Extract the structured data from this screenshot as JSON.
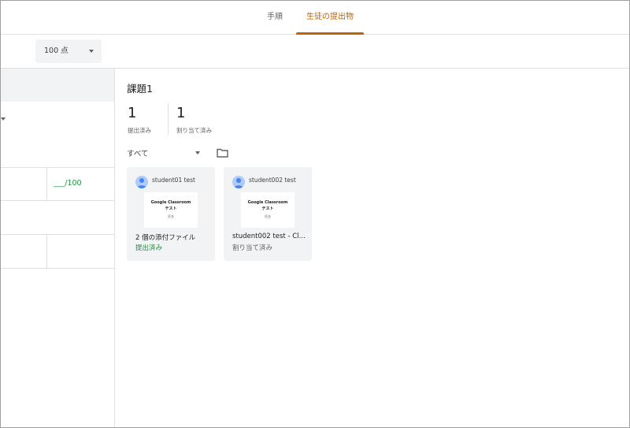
{
  "tabs": [
    {
      "label": "手順",
      "active": false
    },
    {
      "label": "生徒の提出物",
      "active": true
    }
  ],
  "toolbar": {
    "points": "100 点"
  },
  "grade": "___/100",
  "assignment": {
    "title": "課題1",
    "turned_in": {
      "count": "1",
      "label": "提出済み"
    },
    "assigned": {
      "count": "1",
      "label": "割り当て済み"
    }
  },
  "filter": {
    "label": "すべて"
  },
  "students": [
    {
      "name": "student01 test",
      "thumb_title": "Google Classroom",
      "thumb_sub": "テスト",
      "thumb_note": "氏名",
      "attachment": "2 個の添付ファイル",
      "status": "提出済み",
      "status_color": "#1e8e3e"
    },
    {
      "name": "student002 test",
      "thumb_title": "Google Classroom",
      "thumb_sub": "テスト",
      "thumb_note": "氏名",
      "attachment": "student002 test - Clas...",
      "status": "割り当て済み",
      "status_color": "#5f6368"
    }
  ],
  "colors": {
    "accent": "#c26401",
    "turned_in": "#1e8e3e",
    "panel_gray": "#f1f3f4"
  }
}
